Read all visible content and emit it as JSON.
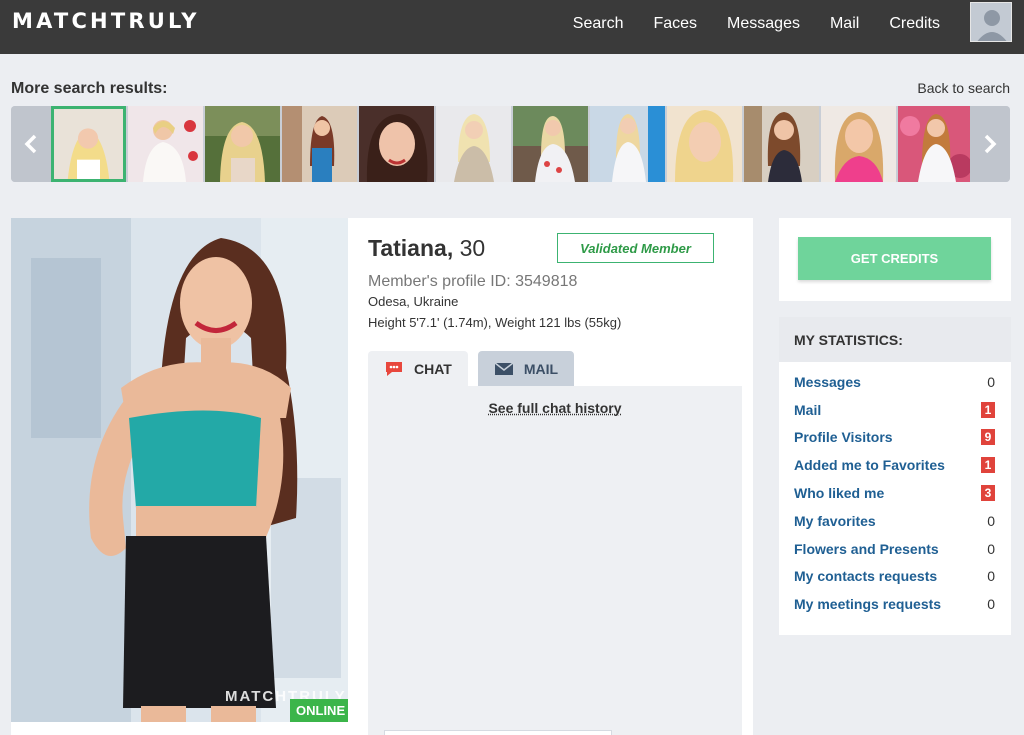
{
  "header": {
    "logo": "MATCHTRULY",
    "nav": [
      "Search",
      "Faces",
      "Messages",
      "Mail",
      "Credits"
    ]
  },
  "results": {
    "title": "More search results:",
    "back_label": "Back to search"
  },
  "profile": {
    "name": "Tatiana,",
    "age": "30",
    "badge": "Validated Member",
    "profile_id": "Member's profile ID: 3549818",
    "location": "Odesa, Ukraine",
    "height_weight": "Height 5'7.1' (1.74m), Weight 121 lbs (55kg)",
    "online_label": "ONLINE",
    "watermark": "MATCHTRULY"
  },
  "tabs": {
    "chat": "CHAT",
    "mail": "MAIL"
  },
  "chat": {
    "history_link": "See full chat history"
  },
  "credits": {
    "button": "GET CREDITS"
  },
  "stats": {
    "title": "MY STATISTICS:",
    "rows": [
      {
        "label": "Messages",
        "value": "0",
        "highlight": false
      },
      {
        "label": "Mail",
        "value": "1",
        "highlight": true
      },
      {
        "label": "Profile Visitors",
        "value": "9",
        "highlight": true
      },
      {
        "label": "Added me to Favorites",
        "value": "1",
        "highlight": true
      },
      {
        "label": "Who liked me",
        "value": "3",
        "highlight": true
      },
      {
        "label": "My favorites",
        "value": "0",
        "highlight": false
      },
      {
        "label": "Flowers and Presents",
        "value": "0",
        "highlight": false
      },
      {
        "label": "My contacts requests",
        "value": "0",
        "highlight": false
      },
      {
        "label": "My meetings requests",
        "value": "0",
        "highlight": false
      }
    ]
  },
  "colors": {
    "topbar": "#3a3a3a",
    "accent_green": "#3cb371",
    "credits_button": "#6fd49b",
    "link_blue": "#1f5f93",
    "badge_red": "#e0433b"
  }
}
